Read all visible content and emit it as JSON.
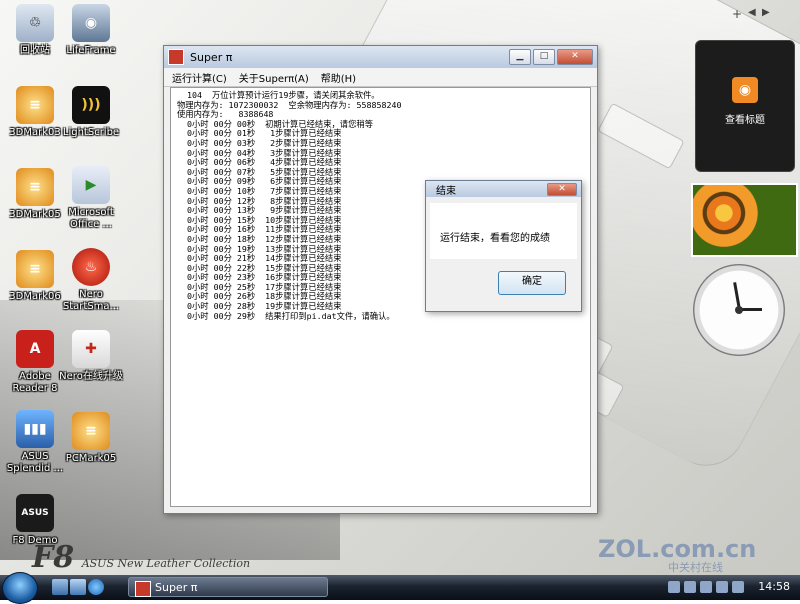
{
  "desktop": {
    "brand": {
      "f8": "F8",
      "collection": "ASUS New Leather Collection"
    },
    "watermark": {
      "main": "ZOL.com.cn",
      "sub": "中关村在线"
    },
    "icons": [
      {
        "label": "回收站"
      },
      {
        "label": "LifeFrame"
      },
      {
        "label": "3DMark03"
      },
      {
        "label": "LightScribe"
      },
      {
        "label": "3DMark05"
      },
      {
        "label": "Microsoft Office ..."
      },
      {
        "label": "3DMark06"
      },
      {
        "label": "Nero StartSma..."
      },
      {
        "label": "Adobe Reader 8"
      },
      {
        "label": "Nero在线升级"
      },
      {
        "label": "ASUS Splendid ..."
      },
      {
        "label": "PCMark05"
      },
      {
        "label": "F8 Demo"
      }
    ]
  },
  "superpi": {
    "title": "Super π",
    "menu": [
      "运行计算(C)",
      "关于Superπ(A)",
      "帮助(H)"
    ],
    "log_lines": [
      "  104  万位计算预计运行19步骤，请关闭其余软件。",
      "物理内存为: 1072300032  空余物理内存为: 558858240",
      "使用内存为:   8388648",
      "  0小时 00分 00秒  初期计算已经结束，请您稍等",
      "  0小时 00分 01秒   1步骤计算已经结束",
      "  0小时 00分 03秒   2步骤计算已经结束",
      "  0小时 00分 04秒   3步骤计算已经结束",
      "  0小时 00分 06秒   4步骤计算已经结束",
      "  0小时 00分 07秒   5步骤计算已经结束",
      "  0小时 00分 09秒   6步骤计算已经结束",
      "  0小时 00分 10秒   7步骤计算已经结束",
      "  0小时 00分 12秒   8步骤计算已经结束",
      "  0小时 00分 13秒   9步骤计算已经结束",
      "  0小时 00分 15秒  10步骤计算已经结束",
      "  0小时 00分 16秒  11步骤计算已经结束",
      "  0小时 00分 18秒  12步骤计算已经结束",
      "  0小时 00分 19秒  13步骤计算已经结束",
      "  0小时 00分 21秒  14步骤计算已经结束",
      "  0小时 00分 22秒  15步骤计算已经结束",
      "  0小时 00分 23秒  16步骤计算已经结束",
      "  0小时 00分 25秒  17步骤计算已经结束",
      "  0小时 00分 26秒  18步骤计算已经结束",
      "  0小时 00分 28秒  19步骤计算已经结束",
      "  0小时 00分 29秒  结果打印到pi.dat文件，请确认。"
    ]
  },
  "dialog": {
    "title": "结束",
    "message": "运行结束，看看您的成绩",
    "ok": "确定"
  },
  "sidebar": {
    "feed_label": "查看标题"
  },
  "taskbar": {
    "task_label": "Super π",
    "time": "14:58"
  }
}
